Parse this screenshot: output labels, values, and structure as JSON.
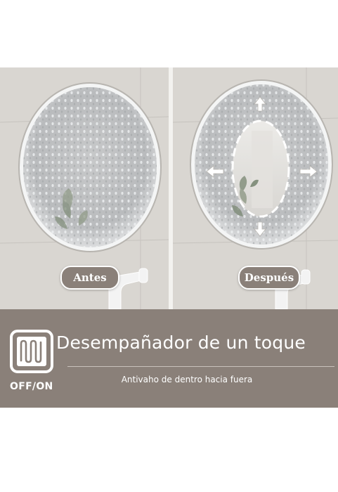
{
  "labels": {
    "before": "Antes",
    "after": "Después"
  },
  "feature": {
    "title": "Desempañador de un toque",
    "subtitle": "Antivaho de dentro hacia fuera",
    "switch_label": "OFF/ON",
    "switch_icon": "defogger-heating-icon"
  },
  "colors": {
    "band": "#8a8079",
    "wall": "#d9d6d1",
    "text": "#ffffff"
  }
}
